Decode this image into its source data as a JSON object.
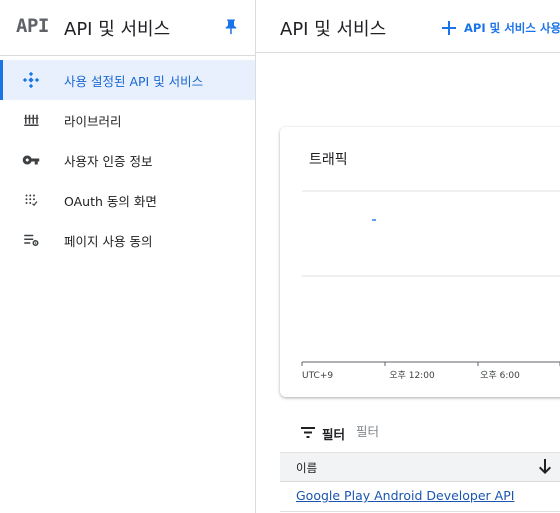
{
  "sidebar": {
    "logo": "API",
    "title": "API 및 서비스",
    "items": [
      {
        "label": "사용 설정된 API 및 서비스",
        "icon": "diamond-grid-icon",
        "active": true
      },
      {
        "label": "라이브러리",
        "icon": "library-icon",
        "active": false
      },
      {
        "label": "사용자 인증 정보",
        "icon": "key-icon",
        "active": false
      },
      {
        "label": "OAuth 동의 화면",
        "icon": "dots-grid-icon",
        "active": false
      },
      {
        "label": "페이지 사용 동의",
        "icon": "list-settings-icon",
        "active": false
      }
    ]
  },
  "header": {
    "title": "API 및 서비스",
    "enable_label": "API 및 서비스 사용"
  },
  "traffic": {
    "title": "트래픽"
  },
  "chart_data": {
    "type": "line",
    "title": "트래픽",
    "x_ticks": [
      "UTC+9",
      "오후 12:00",
      "오후 6:00"
    ],
    "series": [],
    "grid": true
  },
  "filter": {
    "label": "필터",
    "placeholder": "필터"
  },
  "table": {
    "columns": [
      "이름"
    ],
    "rows": [
      {
        "name": "Google Play Android Developer API"
      }
    ]
  },
  "colors": {
    "accent": "#1a73e8",
    "active_bg": "#e8f0fe",
    "divider": "#dadce0"
  }
}
